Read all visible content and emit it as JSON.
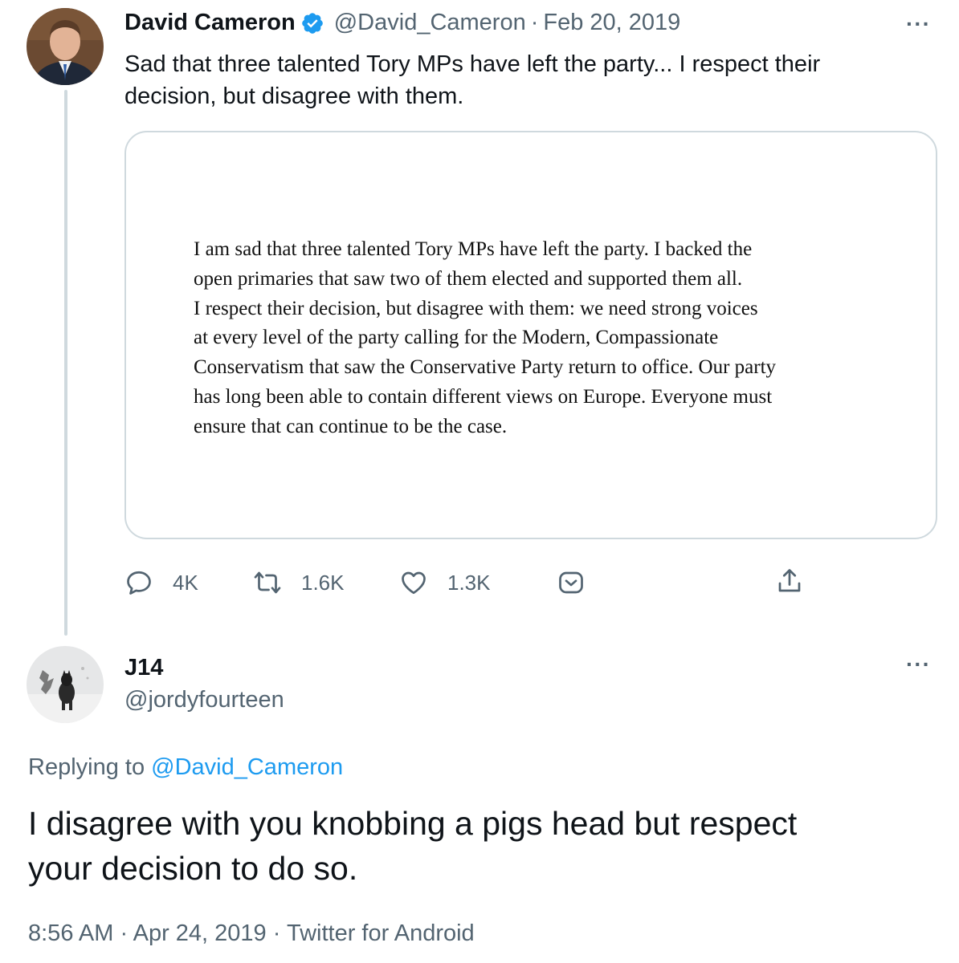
{
  "tweet": {
    "author_name": "David Cameron",
    "verified": true,
    "handle": "@David_Cameron",
    "separator": "·",
    "date": "Feb 20, 2019",
    "text_line1": "Sad that three talented Tory MPs have left the party... I respect their",
    "text_line2": "decision, but disagree with them.",
    "statement_lines": [
      "I am sad that three talented Tory MPs have left the party. I backed the",
      "open primaries that saw two of them elected and supported them all.",
      "I respect their decision, but disagree with them: we need strong voices",
      "at every level of the party calling for the Modern, Compassionate",
      "Conservatism that saw the Conservative Party return to office. Our party",
      "has long been able to contain different views on Europe. Everyone must",
      "ensure that can continue to be the case."
    ],
    "reply_count": "4K",
    "retweet_count": "1.6K",
    "like_count": "1.3K",
    "more_label": "···"
  },
  "reply": {
    "author_name": "J14",
    "handle": "@jordyfourteen",
    "replying_prefix": "Replying to",
    "replying_to": "@David_Cameron",
    "text_line1": "I disagree with you knobbing a pigs head but respect",
    "text_line2": "your decision to do so.",
    "time": "8:56 AM",
    "date": "Apr 24, 2019",
    "source": "Twitter for Android",
    "separator": "·",
    "more_label": "···"
  },
  "colors": {
    "verified": "#1d9bf0",
    "link": "#1d9bf0",
    "muted": "#536471",
    "border": "#cfd9de"
  },
  "icons": [
    "verified-badge-icon",
    "reply-icon",
    "retweet-icon",
    "like-icon",
    "tip-jar-icon",
    "share-icon",
    "more-icon"
  ]
}
